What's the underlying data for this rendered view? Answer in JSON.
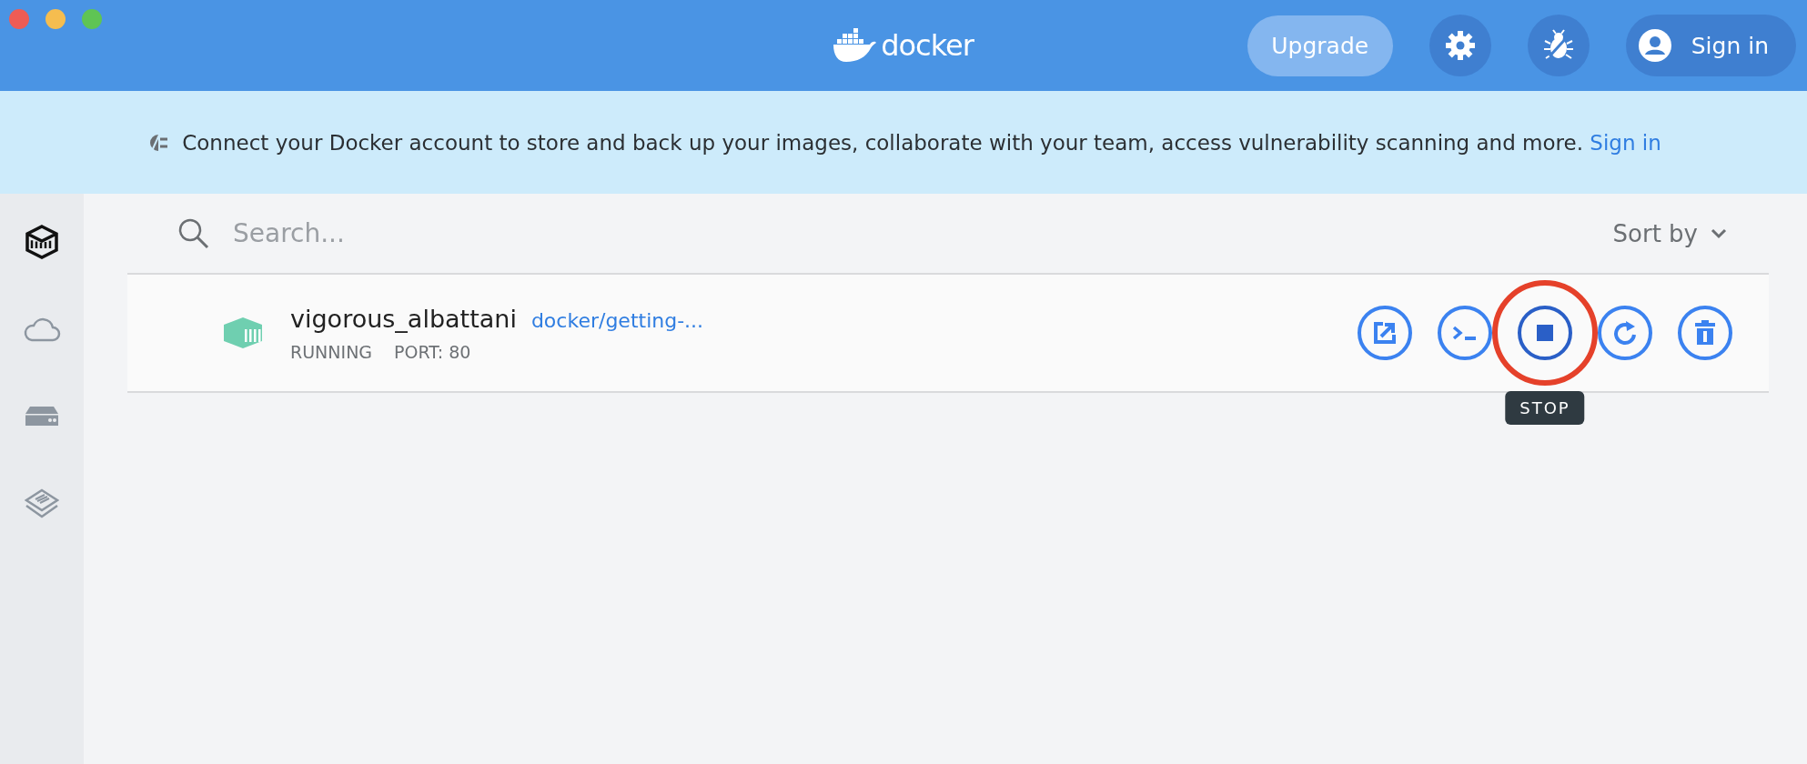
{
  "header": {
    "logo_text": "docker",
    "upgrade_button": "Upgrade",
    "sign_in_button": "Sign in"
  },
  "banner": {
    "text": "Connect your Docker account to store and back up your images, collaborate with your team, access vulnerability scanning and more.",
    "link": "Sign in"
  },
  "sidebar": {
    "items": [
      {
        "kind": "containers",
        "selected": true
      },
      {
        "kind": "cloud",
        "selected": false
      },
      {
        "kind": "storage",
        "selected": false
      },
      {
        "kind": "layers",
        "selected": false
      }
    ]
  },
  "search": {
    "placeholder": "Search..."
  },
  "sort": {
    "label": "Sort by"
  },
  "containers": [
    {
      "name": "vigorous_albattani",
      "image": "docker/getting-...",
      "status": "RUNNING",
      "port": "PORT: 80",
      "running": true,
      "actions": [
        {
          "kind": "open",
          "hovered": false,
          "annotated": false
        },
        {
          "kind": "cli",
          "hovered": false,
          "annotated": false
        },
        {
          "kind": "stop",
          "hovered": true,
          "annotated": true,
          "tooltip": "STOP"
        },
        {
          "kind": "restart",
          "hovered": false,
          "annotated": false
        },
        {
          "kind": "delete",
          "hovered": false,
          "annotated": false
        }
      ]
    }
  ]
}
